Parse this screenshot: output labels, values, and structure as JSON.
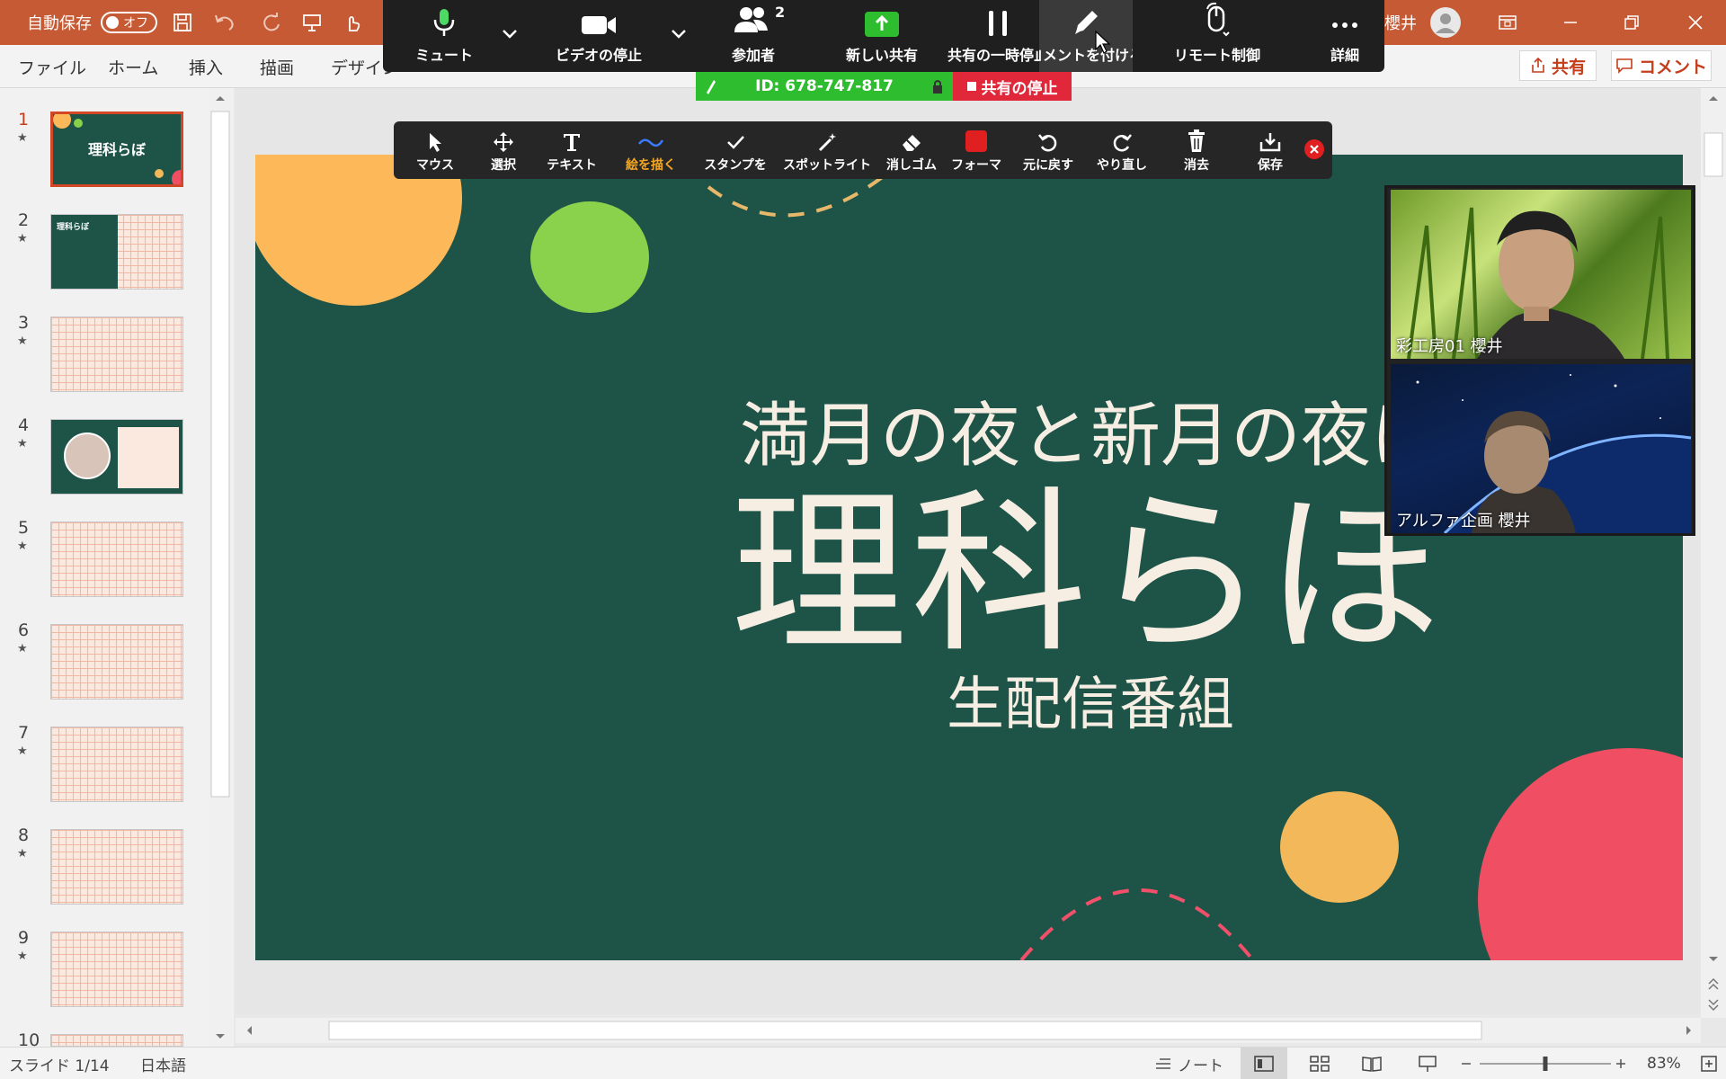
{
  "titlebar": {
    "autosave_label": "自動保存",
    "autosave_state": "オフ",
    "user_name": "櫻井"
  },
  "ribbon": {
    "tabs": [
      "ファイル",
      "ホーム",
      "挿入",
      "描画",
      "デザイン"
    ],
    "share_label": "共有",
    "comment_label": "コメント"
  },
  "zoom_toolbar": {
    "items": [
      {
        "label": "ミュート",
        "icon": "microphone-icon"
      },
      {
        "label": "ビデオの停止",
        "icon": "video-camera-icon"
      },
      {
        "label": "参加者",
        "icon": "participants-icon",
        "count": "2"
      },
      {
        "label": "新しい共有",
        "icon": "share-up-arrow-icon"
      },
      {
        "label": "共有の一時停止",
        "icon": "pause-icon"
      },
      {
        "label": "コメントを付ける",
        "icon": "pencil-icon"
      },
      {
        "label": "リモート制御",
        "icon": "mouse-icon"
      },
      {
        "label": "詳細",
        "icon": "more-dots-icon"
      }
    ],
    "meeting_id": "ID: 678-747-817",
    "stop_share": "共有の停止"
  },
  "annotation_toolbar": {
    "items": [
      {
        "label": "マウス",
        "icon": "cursor-icon"
      },
      {
        "label": "選択",
        "icon": "move-icon"
      },
      {
        "label": "テキスト",
        "icon": "text-icon"
      },
      {
        "label": "絵を描く",
        "icon": "draw-squiggle-icon",
        "active": true
      },
      {
        "label": "スタンプを",
        "icon": "checkmark-stamp-icon"
      },
      {
        "label": "スポットライト",
        "icon": "magic-wand-icon"
      },
      {
        "label": "消しゴム",
        "icon": "eraser-icon"
      },
      {
        "label": "フォーマ",
        "icon": "color-format-icon"
      },
      {
        "label": "元に戻す",
        "icon": "undo-icon"
      },
      {
        "label": "やり直し",
        "icon": "redo-icon"
      },
      {
        "label": "消去",
        "icon": "trash-icon"
      },
      {
        "label": "保存",
        "icon": "save-download-icon"
      }
    ],
    "active_color": "#f5a623",
    "format_color": "#e02020"
  },
  "slide": {
    "line1": "満月の夜と新月の夜は",
    "title": "理科らぼ",
    "subtitle": "生配信番組",
    "background": "#1e5448"
  },
  "thumbnails": {
    "numbers": [
      "1",
      "2",
      "3",
      "4",
      "5",
      "6",
      "7",
      "8",
      "9",
      "10"
    ],
    "slide1_title": "理科らぼ",
    "slide2_title": "理科らぼ"
  },
  "participants": [
    {
      "name": "彩工房01 櫻井"
    },
    {
      "name": "アルファ企画 櫻井"
    }
  ],
  "statusbar": {
    "slide_info": "スライド 1/14",
    "language": "日本語",
    "notes_label": "ノート",
    "zoom": "83%",
    "zoom_fraction": 0.5
  }
}
